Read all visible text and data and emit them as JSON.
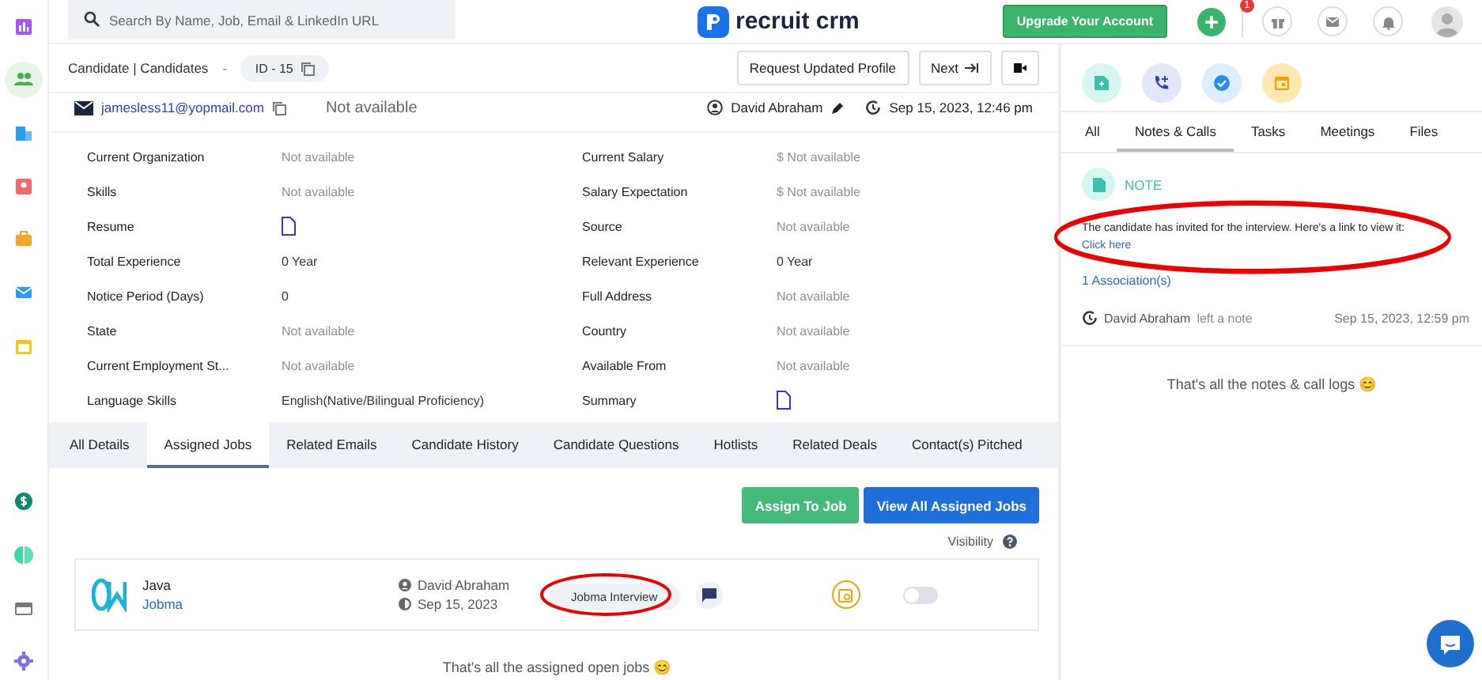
{
  "topbar": {
    "search": {
      "placeholder": "Search By Name, Job, Email & LinkedIn URL"
    },
    "logo_text": "recruit crm",
    "upgrade_button": "Upgrade Your Account",
    "gift_badge": "1"
  },
  "sidebar": {
    "items": [
      {
        "kind": "chart",
        "selected": false
      },
      {
        "kind": "people",
        "selected": true
      },
      {
        "kind": "building",
        "selected": false
      },
      {
        "kind": "contact",
        "selected": false
      },
      {
        "kind": "briefcase",
        "selected": false
      },
      {
        "kind": "mail",
        "selected": false
      },
      {
        "kind": "calendar",
        "selected": false
      }
    ],
    "bottom_items": [
      {
        "kind": "dollar"
      },
      {
        "kind": "pie"
      },
      {
        "kind": "card"
      },
      {
        "kind": "gear"
      }
    ]
  },
  "candidate": {
    "breadcrumb": "Candidate | Candidates",
    "separator": "-",
    "id": "ID - 15",
    "buttons": [
      "Request Updated Profile",
      "Next"
    ],
    "email": "jamesless11@yopmail.com",
    "phone": "Not available",
    "owner": "David Abraham",
    "updated": "Sep 15, 2023, 12:46 pm"
  },
  "details": [
    {
      "label": "Current Organization",
      "kind": "text",
      "value": "Not available",
      "empty": true
    },
    {
      "label": "Current Salary",
      "kind": "text",
      "value": "$ Not available",
      "empty": true
    },
    {
      "label": "Skills",
      "kind": "text",
      "value": "Not available",
      "empty": true
    },
    {
      "label": "Salary Expectation",
      "kind": "text",
      "value": "$ Not available",
      "empty": true
    },
    {
      "label": "Resume",
      "kind": "file"
    },
    {
      "label": "Source",
      "kind": "text",
      "value": "Not available",
      "empty": true
    },
    {
      "label": "Total Experience",
      "kind": "text",
      "value": "0 Year",
      "empty": false
    },
    {
      "label": "Relevant Experience",
      "kind": "text",
      "value": "0 Year",
      "empty": false
    },
    {
      "label": "Notice Period (Days)",
      "kind": "text",
      "value": "0",
      "empty": false
    },
    {
      "label": "Full Address",
      "kind": "text",
      "value": "Not available",
      "empty": true
    },
    {
      "label": "State",
      "kind": "text",
      "value": "Not available",
      "empty": true
    },
    {
      "label": "Country",
      "kind": "text",
      "value": "Not available",
      "empty": true
    },
    {
      "label": "Current Employment St...",
      "kind": "text",
      "value": "Not available",
      "empty": true
    },
    {
      "label": "Available From",
      "kind": "text",
      "value": "Not available",
      "empty": true
    },
    {
      "label": "Language Skills",
      "kind": "text",
      "value": "English(Native/Bilingual Proficiency)",
      "empty": false
    },
    {
      "label": "Summary",
      "kind": "file"
    }
  ],
  "tabs": [
    {
      "label": "All Details",
      "selected": false
    },
    {
      "label": "Assigned Jobs",
      "selected": true
    },
    {
      "label": "Related Emails",
      "selected": false
    },
    {
      "label": "Candidate History",
      "selected": false
    },
    {
      "label": "Candidate Questions",
      "selected": false
    },
    {
      "label": "Hotlists",
      "selected": false
    },
    {
      "label": "Related Deals",
      "selected": false
    },
    {
      "label": "Contact(s) Pitched",
      "selected": false
    }
  ],
  "jobs_actions": [
    "Assign To Job",
    "View All Assigned Jobs"
  ],
  "visibility_label": "Visibility",
  "jobs": [
    {
      "title": "Java",
      "company": "Jobma",
      "owner": "David Abraham",
      "date": "Sep 15, 2023",
      "stage": "Jobma Interview",
      "visible": false
    }
  ],
  "jobs_footer": "That's all the assigned open jobs 😊",
  "activity": {
    "actions": [
      {
        "kind": "note"
      },
      {
        "kind": "call"
      },
      {
        "kind": "task"
      },
      {
        "kind": "meeting"
      }
    ],
    "tabs": [
      {
        "label": "All",
        "selected": false
      },
      {
        "label": "Notes & Calls",
        "selected": true
      },
      {
        "label": "Tasks",
        "selected": false
      },
      {
        "label": "Meetings",
        "selected": false
      },
      {
        "label": "Files",
        "selected": false
      }
    ],
    "notes": [
      {
        "type": "NOTE",
        "text": "The candidate has invited for the interview. Here's a link to view it:",
        "link": "Click here",
        "associations": "1 Association(s)",
        "author": "David Abraham",
        "action": "left a note",
        "time": "Sep 15, 2023, 12:59 pm"
      }
    ],
    "footer": "That's all the notes & call logs 😊"
  }
}
